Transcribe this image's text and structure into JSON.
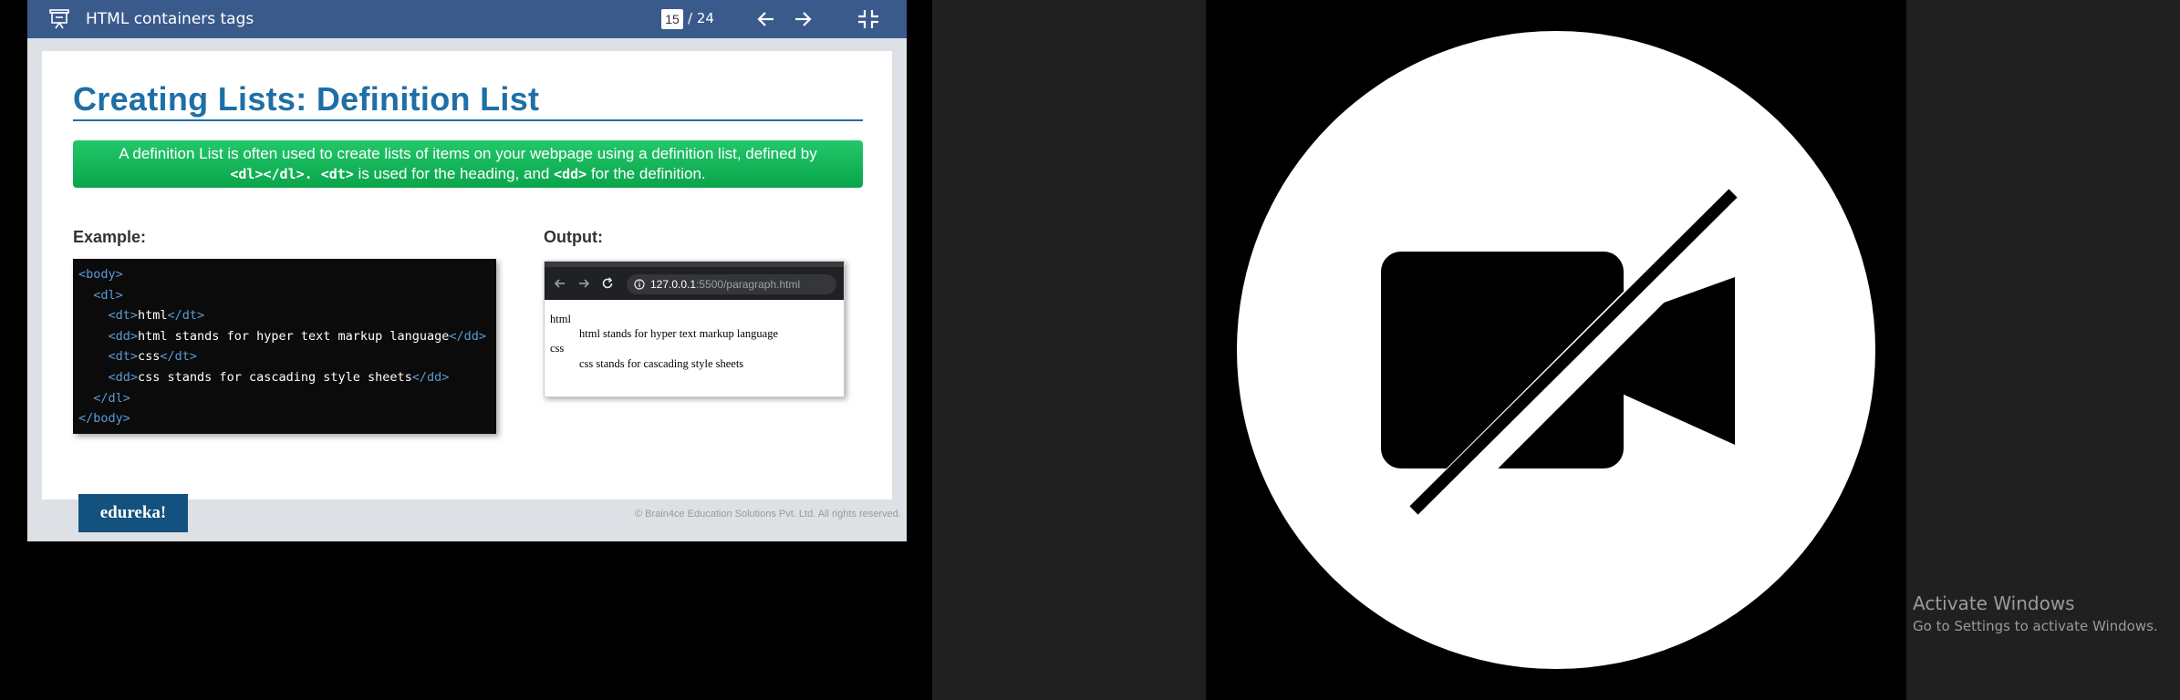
{
  "presentation": {
    "title": "HTML containers tags",
    "current_page": "15",
    "page_total": "/ 24"
  },
  "slide": {
    "title": "Creating Lists: Definition List",
    "banner": {
      "line1": "A definition List is often used to create lists of items on your webpage using a definition list, defined by",
      "code1": "<dl></dl>. <dt>",
      "mid": " is used for the heading, and ",
      "code2": "<dd>",
      "end": " for the definition."
    },
    "example_label": "Example:",
    "output_label": "Output:",
    "code_lines": [
      {
        "indent": "",
        "open": "<body>",
        "text": "",
        "close": ""
      },
      {
        "indent": "  ",
        "open": "<dl>",
        "text": "",
        "close": ""
      },
      {
        "indent": "    ",
        "open": "<dt>",
        "text": "html",
        "close": "</dt>"
      },
      {
        "indent": "    ",
        "open": "<dd>",
        "text": "html stands for hyper text markup language",
        "close": "</dd>"
      },
      {
        "indent": "    ",
        "open": "<dt>",
        "text": "css",
        "close": "</dt>"
      },
      {
        "indent": "    ",
        "open": "<dd>",
        "text": "css stands for cascading style sheets",
        "close": "</dd>"
      },
      {
        "indent": "  ",
        "open": "</dl>",
        "text": "",
        "close": ""
      },
      {
        "indent": "",
        "open": "</body>",
        "text": "",
        "close": ""
      }
    ],
    "browser": {
      "url_host": "127.0.0.1",
      "url_path": ":5500/paragraph.html",
      "dt1": "html",
      "dd1": "html stands for hyper text markup language",
      "dt2": "css",
      "dd2": "css stands for cascading style sheets"
    },
    "logo": "edureka!",
    "copyright": "© Brain4ce Education Solutions Pvt. Ltd. All rights reserved."
  },
  "video": {
    "icon": "camera-off-icon"
  },
  "watermark": {
    "line1": "Activate Windows",
    "line2": "Go to Settings to activate Windows."
  },
  "colors": {
    "topbar": "#3a5a8c",
    "title_blue": "#1f6fa7",
    "banner_green": "#0aa54b",
    "tag_blue": "#5b9bd5"
  }
}
